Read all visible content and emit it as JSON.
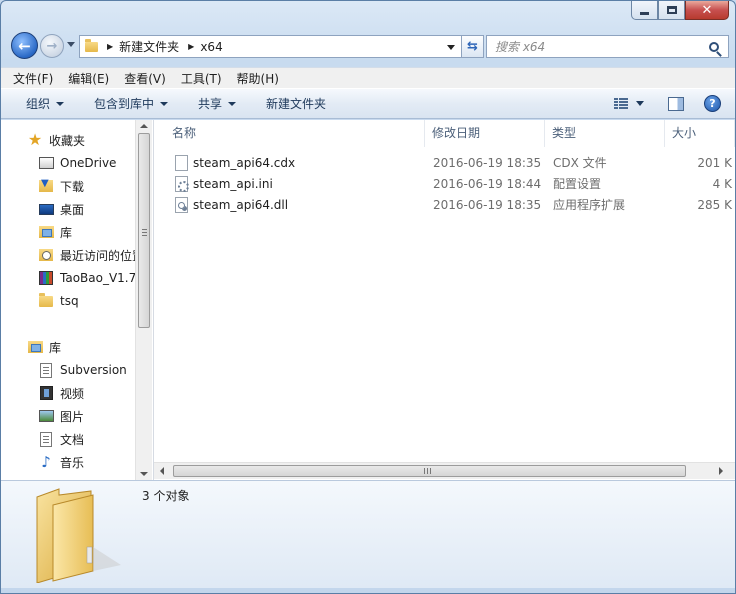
{
  "window": {
    "close_glyph": "✕"
  },
  "navigation": {
    "breadcrumbs": [
      "新建文件夹",
      "x64"
    ],
    "search_placeholder": "搜索 x64"
  },
  "menu": [
    "文件(F)",
    "编辑(E)",
    "查看(V)",
    "工具(T)",
    "帮助(H)"
  ],
  "commands": {
    "organize": "组织",
    "include_library": "包含到库中",
    "share": "共享",
    "new_folder": "新建文件夹",
    "help": "?"
  },
  "sidebar": {
    "favorites_label": "收藏夹",
    "favorites": [
      {
        "label": "OneDrive",
        "icon": "onedrive-icon"
      },
      {
        "label": "下载",
        "icon": "download-folder-icon"
      },
      {
        "label": "桌面",
        "icon": "desktop-icon"
      },
      {
        "label": "库",
        "icon": "library-icon"
      },
      {
        "label": "最近访问的位置",
        "icon": "recent-places-icon"
      },
      {
        "label": "TaoBao_V1.7",
        "icon": "winrar-archive-icon"
      },
      {
        "label": "tsq",
        "icon": "folder-icon"
      }
    ],
    "libraries_label": "库",
    "libraries": [
      {
        "label": "Subversion",
        "icon": "document-library-icon"
      },
      {
        "label": "视频",
        "icon": "video-library-icon"
      },
      {
        "label": "图片",
        "icon": "pictures-library-icon"
      },
      {
        "label": "文档",
        "icon": "documents-library-icon"
      },
      {
        "label": "音乐",
        "icon": "music-library-icon"
      }
    ]
  },
  "columns": {
    "name": "名称",
    "modified": "修改日期",
    "type": "类型",
    "size": "大小"
  },
  "files": [
    {
      "name": "steam_api64.cdx",
      "modified": "2016-06-19 18:35",
      "type": "CDX 文件",
      "size": "201 K"
    },
    {
      "name": "steam_api.ini",
      "modified": "2016-06-19 18:44",
      "type": "配置设置",
      "size": "4 K"
    },
    {
      "name": "steam_api64.dll",
      "modified": "2016-06-19 18:35",
      "type": "应用程序扩展",
      "size": "285 K"
    }
  ],
  "status": {
    "item_count": "3 个对象"
  },
  "colors": {
    "accent": "#2a69c6",
    "folder": "#e5b84a",
    "chrome": "#c8dbef"
  }
}
